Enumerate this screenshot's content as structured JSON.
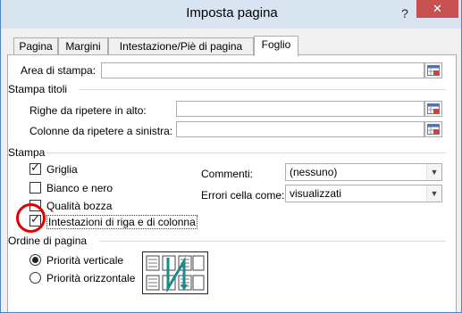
{
  "window": {
    "title": "Imposta pagina",
    "help_label": "?",
    "close_label": "✕"
  },
  "tabs": [
    {
      "label": "Pagina",
      "active": false
    },
    {
      "label": "Margini",
      "active": false
    },
    {
      "label": "Intestazione/Piè di pagina",
      "active": false
    },
    {
      "label": "Foglio",
      "active": true
    }
  ],
  "print_area": {
    "label": "Area di stampa:",
    "value": ""
  },
  "print_titles": {
    "group_label": "Stampa titoli",
    "rows_label": "Righe da ripetere in alto:",
    "rows_value": "",
    "cols_label": "Colonne da ripetere a sinistra:",
    "cols_value": ""
  },
  "print": {
    "group_label": "Stampa",
    "options": [
      {
        "label": "Griglia",
        "checked": true
      },
      {
        "label": "Bianco e nero",
        "checked": false
      },
      {
        "label": "Qualità bozza",
        "checked": false
      },
      {
        "label": "Intestazioni di riga e di colonna",
        "checked": true
      }
    ],
    "comments_label": "Commenti:",
    "comments_value": "(nessuno)",
    "errors_label": "Errori cella come:",
    "errors_value": "visualizzati"
  },
  "page_order": {
    "group_label": "Ordine di pagina",
    "options": [
      {
        "label": "Priorità verticale",
        "selected": true
      },
      {
        "label": "Priorità orizzontale",
        "selected": false
      }
    ]
  },
  "colors": {
    "titlebar": "#d9e4f1",
    "close_button": "#c75050",
    "highlight_circle": "#e00000",
    "preview_arrow": "#1b8a8a"
  },
  "icons": {
    "range_selector": "collapse-dialog-icon",
    "checkmark": "checkmark-icon",
    "dropdown": "chevron-down-icon"
  }
}
